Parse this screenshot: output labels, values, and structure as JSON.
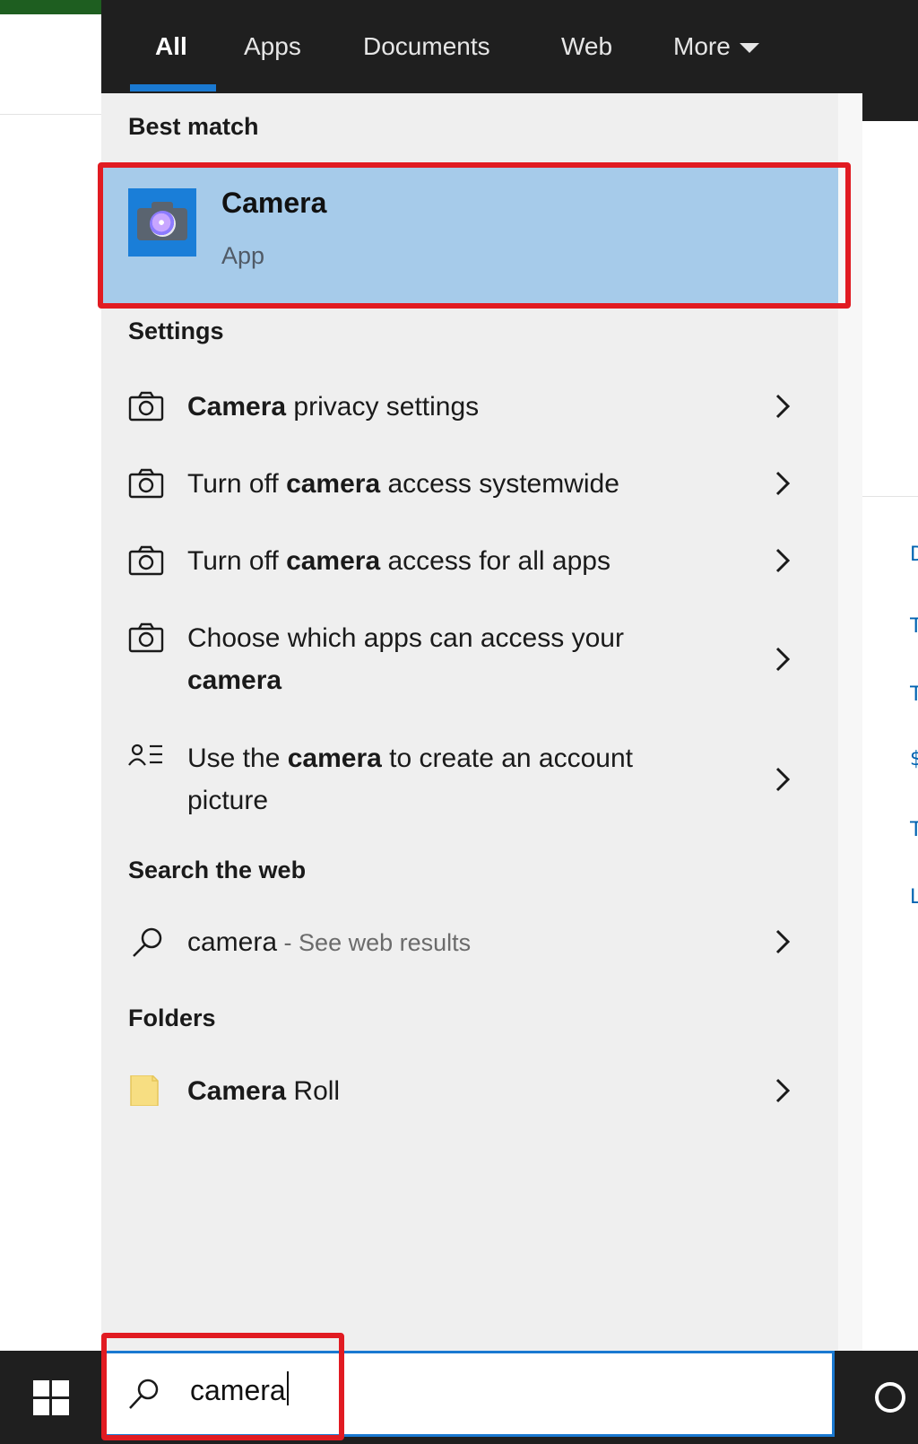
{
  "tabs": [
    {
      "label": "All",
      "active": true
    },
    {
      "label": "Apps"
    },
    {
      "label": "Documents"
    },
    {
      "label": "Web"
    },
    {
      "label": "More"
    }
  ],
  "sections": {
    "best_match": "Best match",
    "settings": "Settings",
    "search_web": "Search the web",
    "folders": "Folders"
  },
  "best_match": {
    "title": "Camera",
    "subtitle": "App",
    "icon": "camera-app-icon"
  },
  "settings_items": [
    {
      "line1": [
        [
          "Camera",
          true
        ],
        [
          " privacy settings",
          false
        ]
      ],
      "icon": "camera-outline-icon"
    },
    {
      "line1": [
        [
          "Turn off ",
          false
        ],
        [
          "camera",
          true
        ],
        [
          " access systemwide",
          false
        ]
      ],
      "icon": "camera-outline-icon"
    },
    {
      "line1": [
        [
          "Turn off ",
          false
        ],
        [
          "camera",
          true
        ],
        [
          " access for all apps",
          false
        ]
      ],
      "icon": "camera-outline-icon"
    },
    {
      "line1": [
        [
          "Choose which apps can access your",
          false
        ]
      ],
      "line2": [
        [
          "camera",
          true
        ]
      ],
      "icon": "camera-outline-icon"
    },
    {
      "line1": [
        [
          "Use the ",
          false
        ],
        [
          "camera",
          true
        ],
        [
          " to create an account",
          false
        ]
      ],
      "line2": [
        [
          "picture",
          false
        ]
      ],
      "icon": "account-list-icon"
    }
  ],
  "web_result": {
    "query": "camera",
    "suffix": " - See web results",
    "icon": "search-icon"
  },
  "folder_item": {
    "bold": "Camera",
    "rest": " Roll",
    "icon": "folder-icon"
  },
  "search_box": {
    "value": "camera"
  },
  "colors": {
    "accent": "#1a79d1",
    "selection": "#a6cbea",
    "highlight_box": "#e11b22",
    "taskbar": "#1f1f1f"
  }
}
